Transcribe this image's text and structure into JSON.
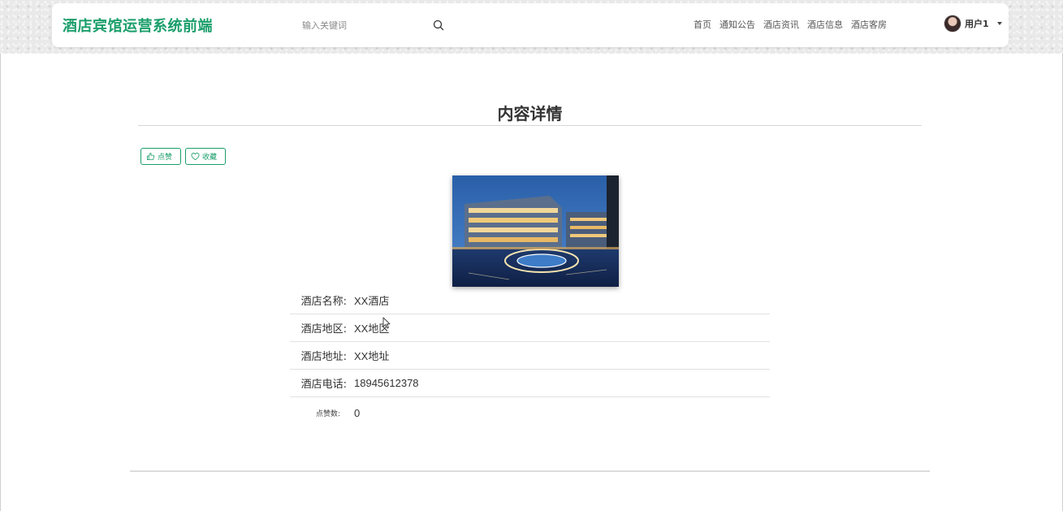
{
  "header": {
    "brand": "酒店宾馆运营系统前端",
    "search": {
      "placeholder": "输入关键词"
    },
    "nav": [
      "首页",
      "通知公告",
      "酒店资讯",
      "酒店信息",
      "酒店客房"
    ],
    "user": {
      "name": "用户1"
    }
  },
  "detail": {
    "title": "内容详情",
    "like_label": "点赞",
    "favorite_label": "收藏",
    "fields": [
      {
        "label": "酒店名称:",
        "value": "XX酒店"
      },
      {
        "label": "酒店地区:",
        "value": "XX地区"
      },
      {
        "label": "酒店地址:",
        "value": "XX地址"
      },
      {
        "label": "酒店电话:",
        "value": "18945612378"
      },
      {
        "label": "点赞数:",
        "value": "0"
      }
    ]
  },
  "colors": {
    "brand": "#1a9e6a",
    "text": "#333333"
  }
}
